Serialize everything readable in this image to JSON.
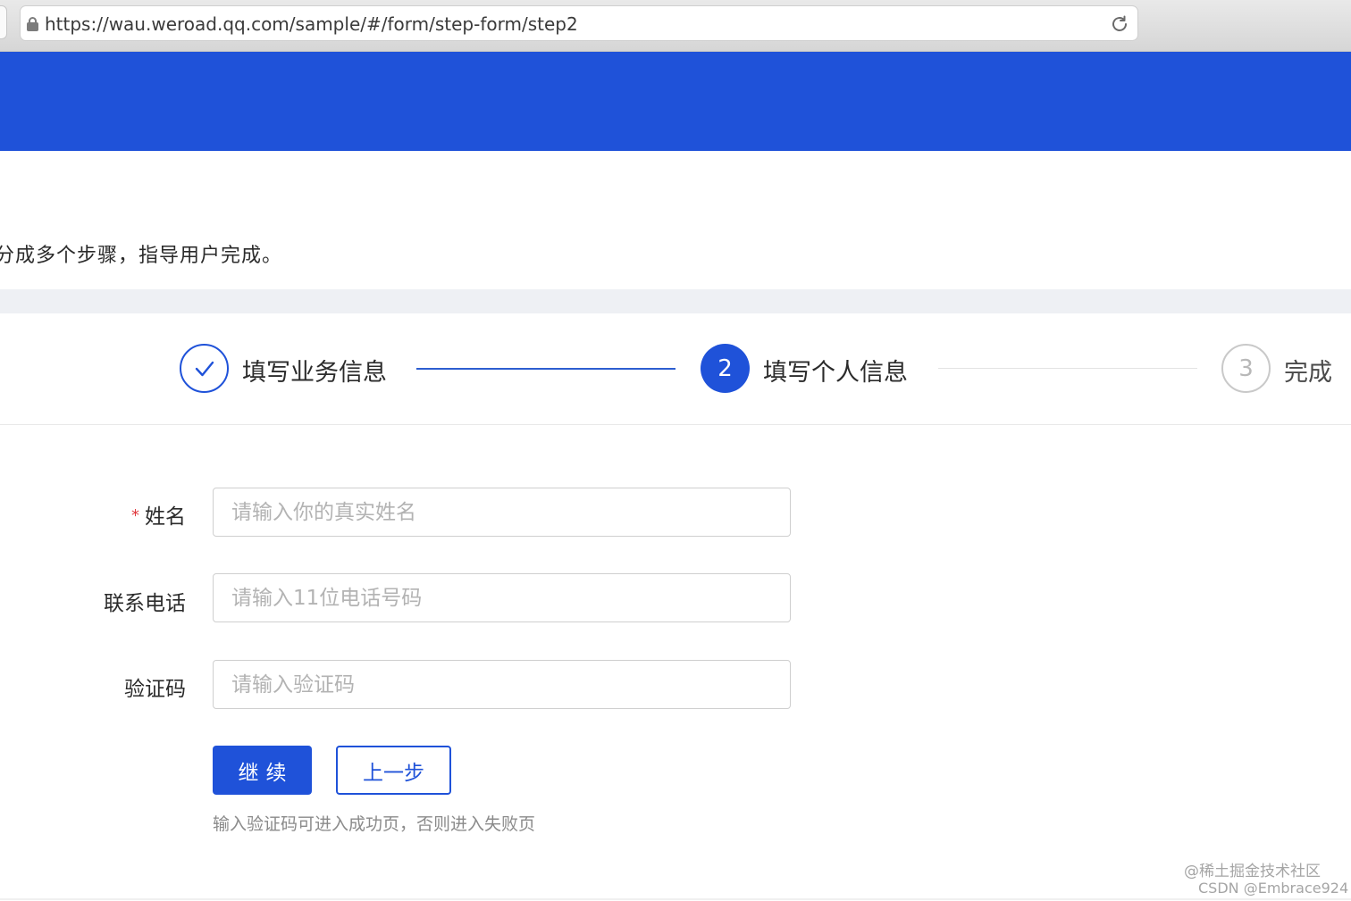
{
  "browser": {
    "url": "https://wau.weroad.qq.com/sample/#/form/step-form/step2"
  },
  "page": {
    "description": "分成多个步骤，指导用户完成。"
  },
  "steps": [
    {
      "index": "1",
      "title": "填写业务信息",
      "status": "finished"
    },
    {
      "index": "2",
      "title": "填写个人信息",
      "status": "process"
    },
    {
      "index": "3",
      "title": "完成",
      "status": "wait"
    }
  ],
  "form": {
    "name": {
      "label": "姓名",
      "required_mark": "*",
      "placeholder": "请输入你的真实姓名"
    },
    "phone": {
      "label": "联系电话",
      "placeholder": "请输入11位电话号码"
    },
    "code": {
      "label": "验证码",
      "placeholder": "请输入验证码"
    },
    "submit_label": "继续",
    "prev_label": "上一步",
    "hint": "输入验证码可进入成功页，否则进入失败页"
  },
  "watermark": {
    "line1": "@稀土掘金技术社区",
    "line2": "CSDN @Embrace924"
  },
  "colors": {
    "primary": "#1f52d9",
    "required": "#e0393e"
  }
}
